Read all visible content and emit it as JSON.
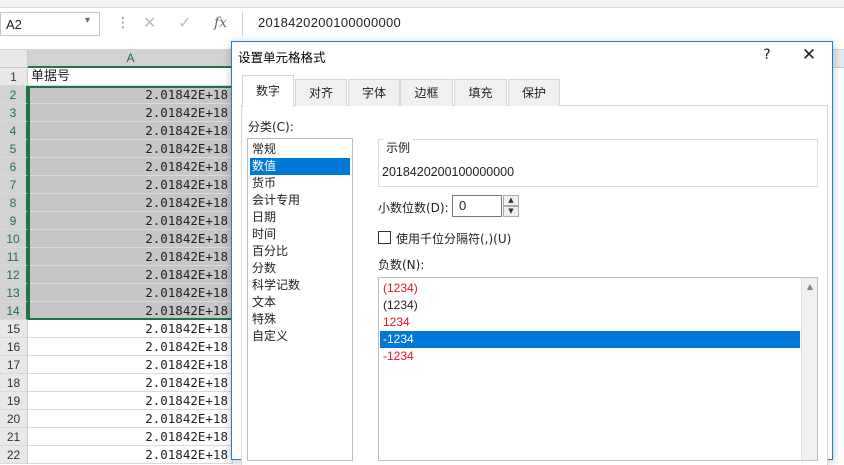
{
  "formula_bar": {
    "name_box": "A2",
    "name_box_dropdown": "▾",
    "separator": "⋮",
    "cancel_glyph": "✕",
    "enter_glyph": "✓",
    "fx": "fx",
    "value": "2018420200100000000"
  },
  "grid": {
    "column_header": "A",
    "rows": [
      {
        "num": "1",
        "value": "单据号"
      },
      {
        "num": "2",
        "value": "2.01842E+18"
      },
      {
        "num": "3",
        "value": "2.01842E+18"
      },
      {
        "num": "4",
        "value": "2.01842E+18"
      },
      {
        "num": "5",
        "value": "2.01842E+18"
      },
      {
        "num": "6",
        "value": "2.01842E+18"
      },
      {
        "num": "7",
        "value": "2.01842E+18"
      },
      {
        "num": "8",
        "value": "2.01842E+18"
      },
      {
        "num": "9",
        "value": "2.01842E+18"
      },
      {
        "num": "10",
        "value": "2.01842E+18"
      },
      {
        "num": "11",
        "value": "2.01842E+18"
      },
      {
        "num": "12",
        "value": "2.01842E+18"
      },
      {
        "num": "13",
        "value": "2.01842E+18"
      },
      {
        "num": "14",
        "value": "2.01842E+18"
      },
      {
        "num": "15",
        "value": "2.01842E+18"
      },
      {
        "num": "16",
        "value": "2.01842E+18"
      },
      {
        "num": "17",
        "value": "2.01842E+18"
      },
      {
        "num": "18",
        "value": "2.01842E+18"
      },
      {
        "num": "19",
        "value": "2.01842E+18"
      },
      {
        "num": "20",
        "value": "2.01842E+18"
      },
      {
        "num": "21",
        "value": "2.01842E+18"
      },
      {
        "num": "22",
        "value": "2.01842E+18"
      }
    ]
  },
  "dialog": {
    "title": "设置单元格格式",
    "help": "?",
    "close": "✕",
    "tabs": [
      "数字",
      "对齐",
      "字体",
      "边框",
      "填充",
      "保护"
    ],
    "category_label": "分类(C):",
    "categories": [
      "常规",
      "数值",
      "货币",
      "会计专用",
      "日期",
      "时间",
      "百分比",
      "分数",
      "科学记数",
      "文本",
      "特殊",
      "自定义"
    ],
    "selected_category": "数值",
    "sample_label": "示例",
    "sample_value": "2018420200100000000",
    "decimal_label": "小数位数(D):",
    "decimal_value": "0",
    "spin_up": "▲",
    "spin_down": "▼",
    "separator_label": "使用千位分隔符(,)(U)",
    "separator_checked": false,
    "negative_label": "负数(N):",
    "negative_options": [
      "(1234)",
      "(1234)",
      "1234",
      "-1234",
      "-1234"
    ],
    "negative_selected": "-1234",
    "scroll_up": "▲"
  },
  "colors": {
    "accent_green": "#217346",
    "selection_blue": "#0078d7",
    "negative_red": "#e81123"
  }
}
